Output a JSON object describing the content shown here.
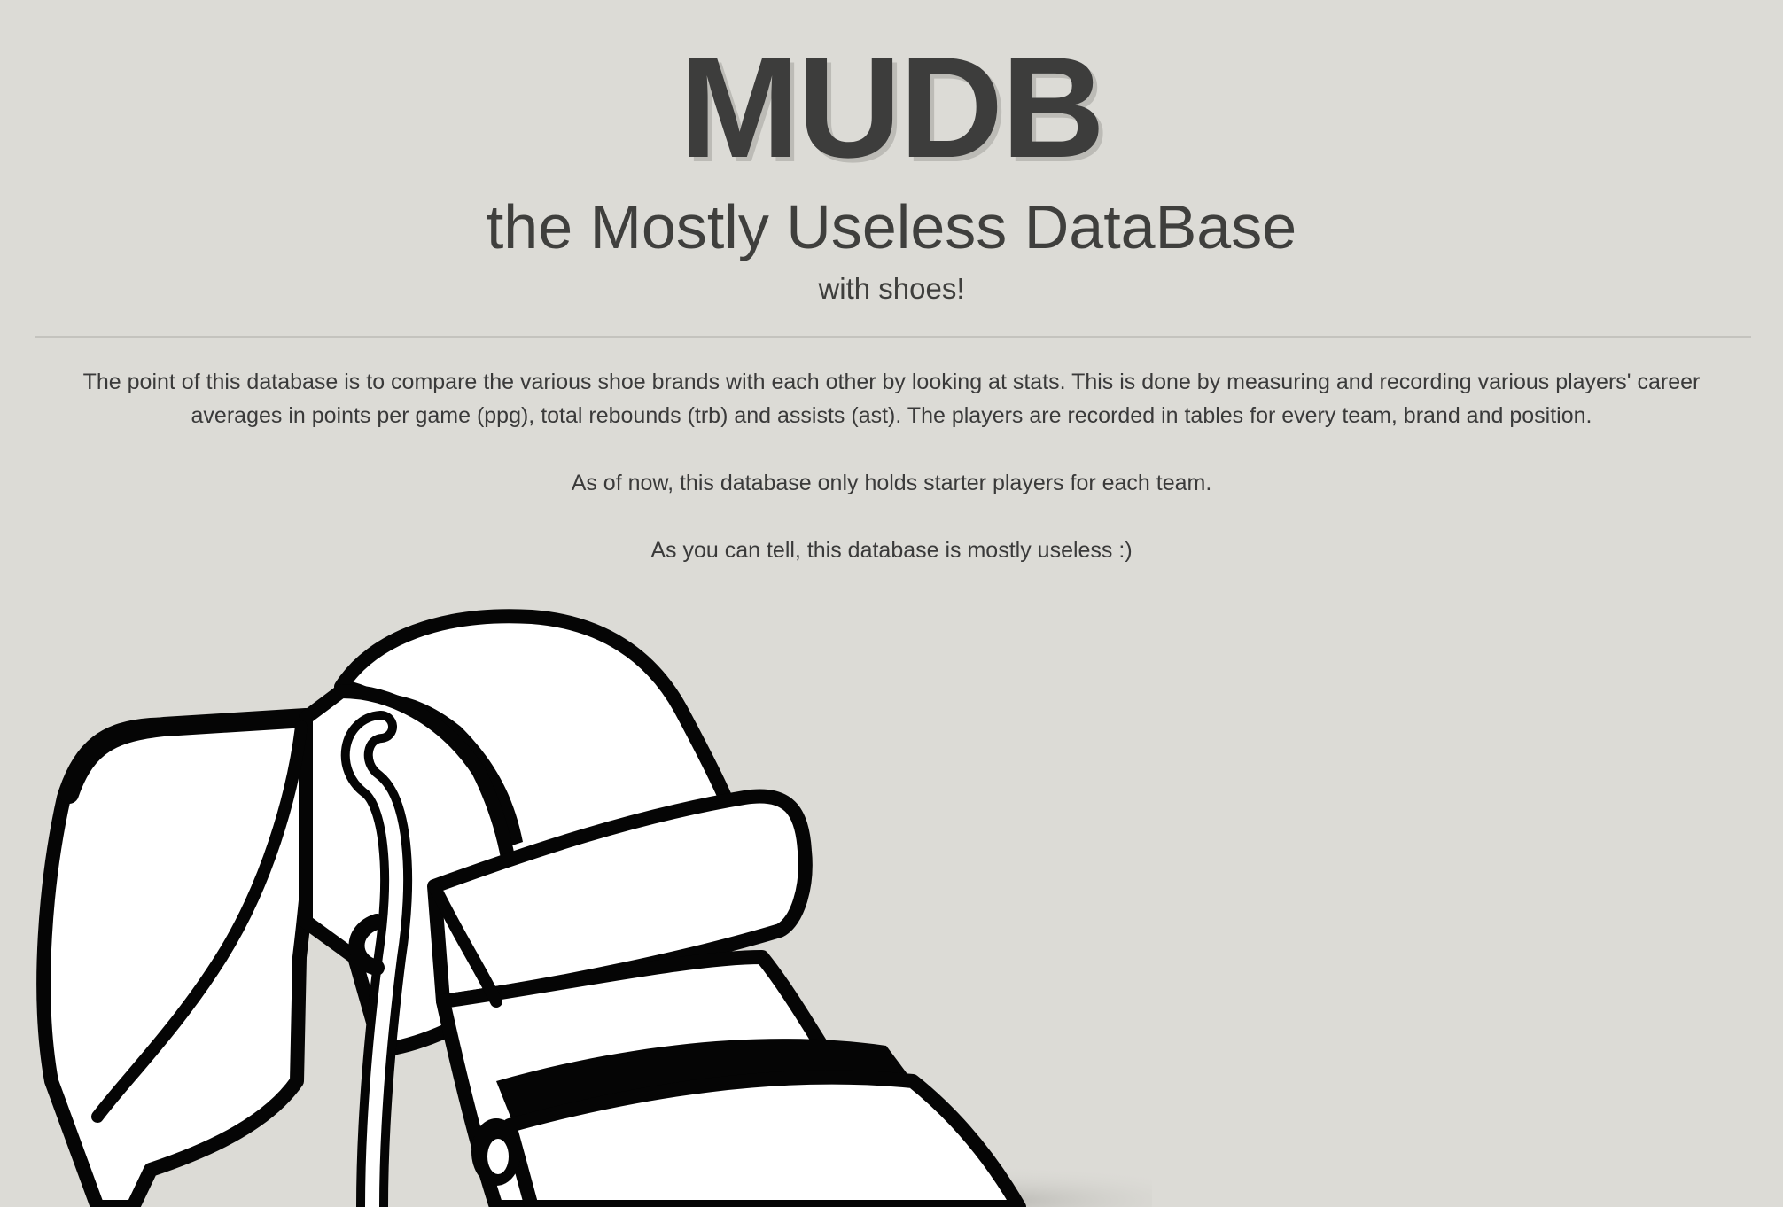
{
  "header": {
    "title": "MUDB",
    "subtitle": "the Mostly Useless DataBase",
    "tagline": "with shoes!"
  },
  "intro": {
    "paragraphs": [
      "The point of this database is to compare the various shoe brands with each other by looking at stats. This is done by measuring and recording various players' career averages in points per game (ppg), total rebounds (trb) and assists (ast). The players are recorded in tables for every team, brand and position.",
      "As of now, this database only holds starter players for each team.",
      "As you can tell, this database is mostly useless :)"
    ]
  },
  "hero": {
    "icon": "sneaker-illustration"
  },
  "colors": {
    "background": "#dcdbd6",
    "text": "#3c3c3c",
    "title_shadow": "#bcbbb6",
    "divider": "#c4c3be"
  }
}
